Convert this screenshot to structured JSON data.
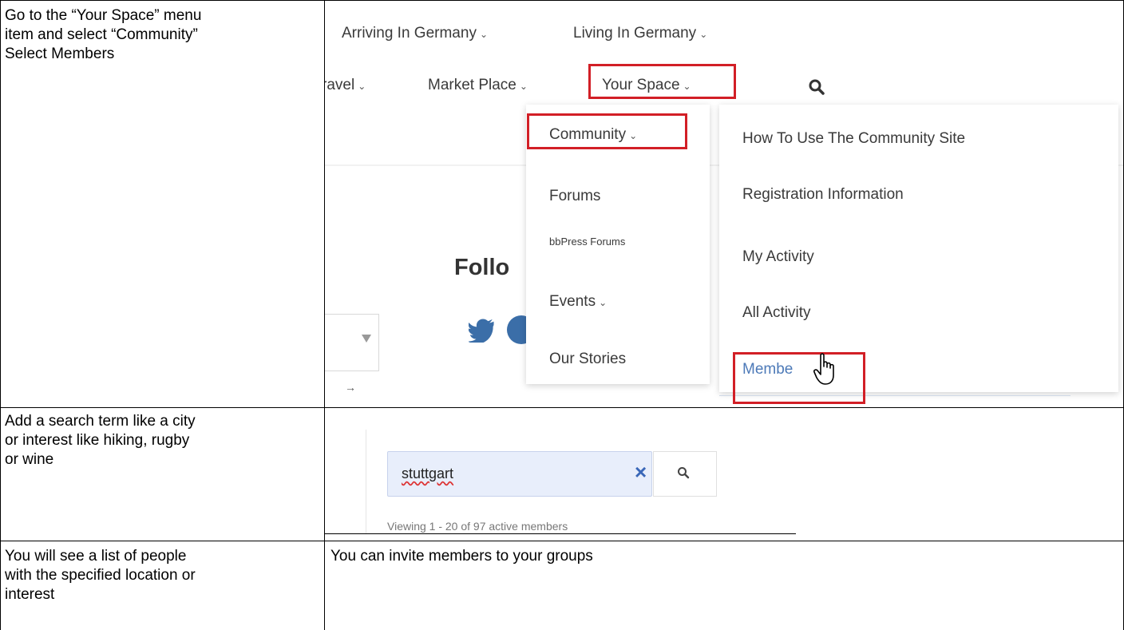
{
  "rows": [
    {
      "instruction": [
        "Go to the “Your Space” menu",
        "item and select “Community”",
        "Select Members"
      ]
    },
    {
      "instruction": [
        "Add a search term like a city",
        "or interest like hiking, rugby",
        "or wine"
      ]
    },
    {
      "instruction": [
        "You will see a list of people",
        "with the specified location or",
        "interest"
      ],
      "note": "You can invite members to your groups"
    }
  ],
  "nav": {
    "row1": [
      "Arriving In Germany",
      "Living In Germany"
    ],
    "row2": [
      "ravel",
      "Market Place",
      "Your Space"
    ]
  },
  "dropdown_left": {
    "header": "Community",
    "items": [
      "Forums",
      "bbPress Forums",
      "Events",
      "Our Stories"
    ]
  },
  "dropdown_right": {
    "items": [
      "How To Use The Community Site",
      "Registration Information",
      "My Activity",
      "All Activity",
      "Membe"
    ]
  },
  "background": {
    "follow_text": "Follo"
  },
  "search": {
    "value": "stuttgart",
    "clear_icon": "×",
    "viewing_text": "Viewing 1 - 20 of 97 active members"
  },
  "colors": {
    "highlight": "#d21f26",
    "link": "#4d7ab8",
    "twitter": "#3b6ea8"
  }
}
